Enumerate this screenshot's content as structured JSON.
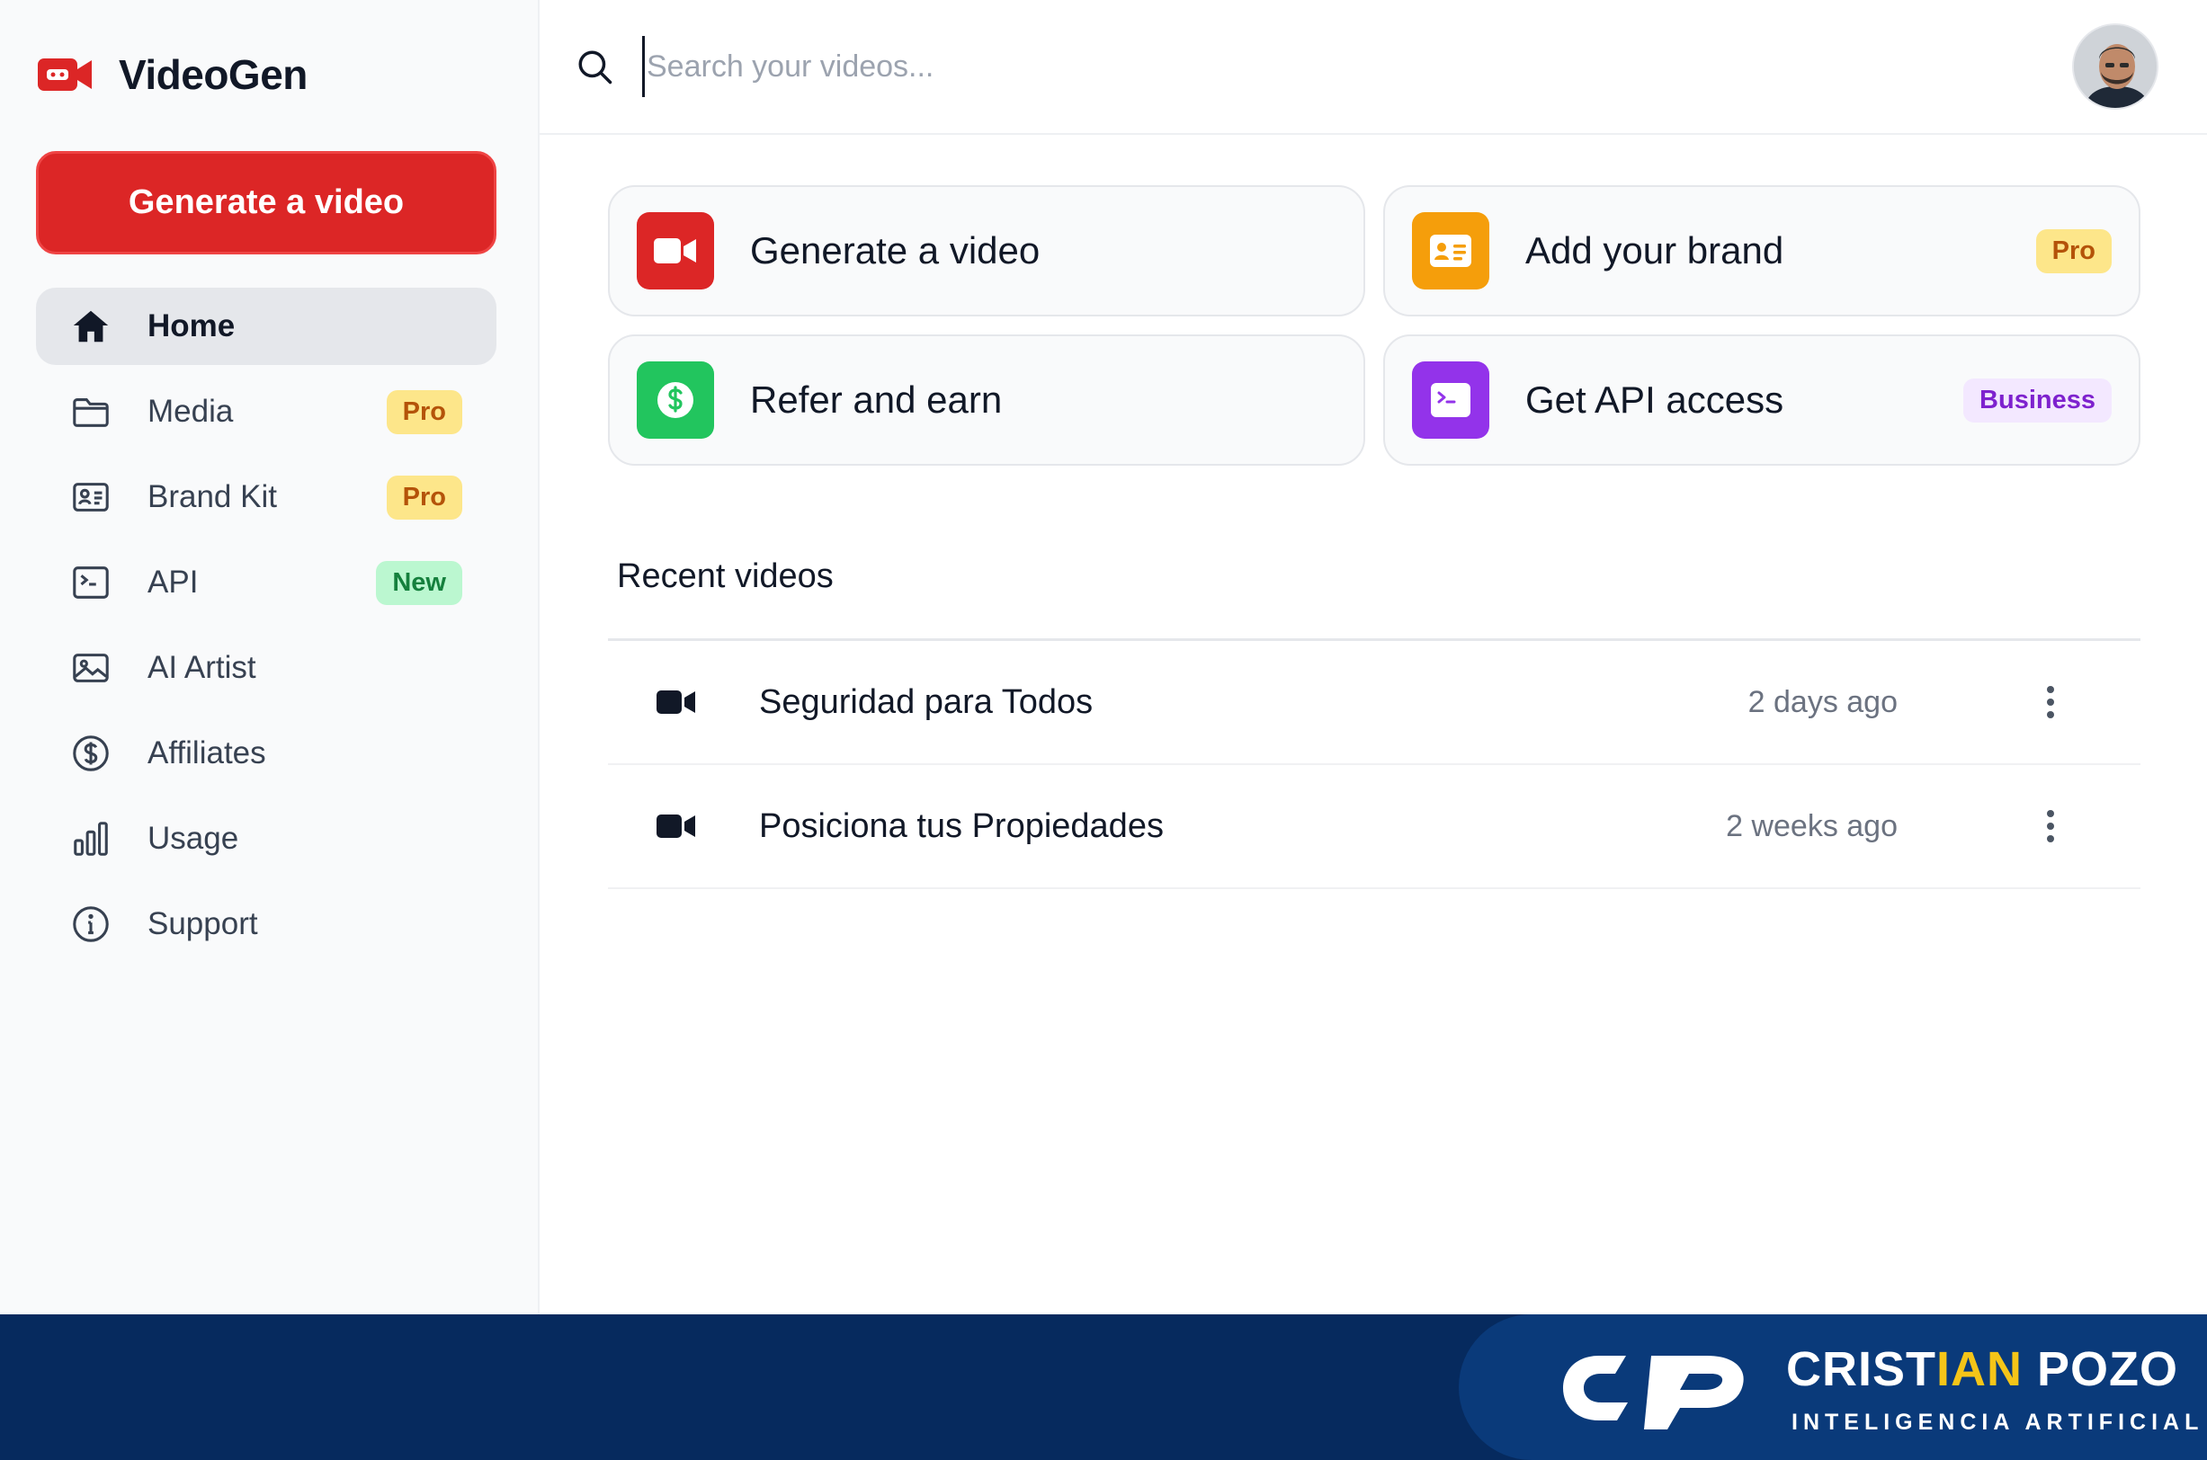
{
  "app": {
    "name": "VideoGen"
  },
  "sidebar": {
    "generate_button": "Generate a video",
    "items": [
      {
        "label": "Home",
        "icon": "home-icon",
        "badge": ""
      },
      {
        "label": "Media",
        "icon": "folder-icon",
        "badge": "Pro"
      },
      {
        "label": "Brand Kit",
        "icon": "id-card-icon",
        "badge": "Pro"
      },
      {
        "label": "API",
        "icon": "terminal-icon",
        "badge": "New"
      },
      {
        "label": "AI Artist",
        "icon": "image-icon",
        "badge": ""
      },
      {
        "label": "Affiliates",
        "icon": "dollar-icon",
        "badge": ""
      },
      {
        "label": "Usage",
        "icon": "bar-chart-icon",
        "badge": ""
      },
      {
        "label": "Support",
        "icon": "info-icon",
        "badge": ""
      }
    ]
  },
  "search": {
    "placeholder": "Search your videos..."
  },
  "cards": [
    {
      "label": "Generate a video",
      "icon": "video-camera-icon",
      "badge": ""
    },
    {
      "label": "Add your brand",
      "icon": "id-card-icon",
      "badge": "Pro"
    },
    {
      "label": "Refer and earn",
      "icon": "dollar-icon",
      "badge": ""
    },
    {
      "label": "Get API access",
      "icon": "terminal-icon",
      "badge": "Business"
    }
  ],
  "recent": {
    "title": "Recent videos",
    "rows": [
      {
        "title": "Seguridad para Todos",
        "time": "2 days ago"
      },
      {
        "title": "Posiciona tus Propiedades",
        "time": "2 weeks ago"
      }
    ]
  },
  "footer": {
    "name_part1": "CRIST",
    "name_highlight": "IAN",
    "name_part2": " POZO",
    "tagline": "INTELIGENCIA ARTIFICIAL"
  },
  "colors": {
    "accent_red": "#dc2626",
    "orange": "#f59e0b",
    "green": "#22c55e",
    "purple": "#9333ea",
    "footer_navy": "#062a5e",
    "footer_highlight": "#f5c518"
  }
}
